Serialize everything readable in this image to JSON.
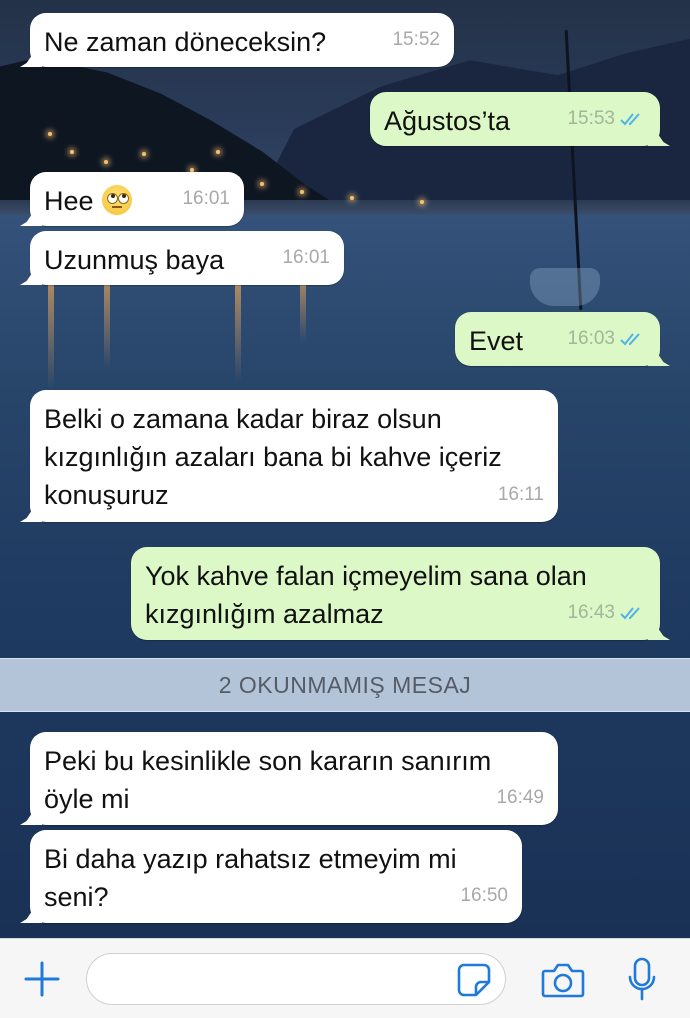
{
  "messages": [
    {
      "dir": "in",
      "text": "Ne zaman döneceksin?",
      "time": "15:52"
    },
    {
      "dir": "out",
      "text": "Ağustos’ta",
      "time": "15:53"
    },
    {
      "dir": "in",
      "text": "Hee",
      "time": "16:01",
      "emoji": "eye-roll-emoji-icon"
    },
    {
      "dir": "in",
      "text": "Uzunmuş baya",
      "time": "16:01"
    },
    {
      "dir": "out",
      "text": "Evet",
      "time": "16:03"
    },
    {
      "dir": "in",
      "text": "Belki o zamana kadar biraz olsun\nkızgınlığın azaları bana bi kahve içeriz\nkonuşuruz",
      "time": "16:11"
    },
    {
      "dir": "out",
      "text": "Yok kahve falan içmeyelim sana olan\nkızgınlığım azalmaz",
      "time": "16:43"
    },
    {
      "dir": "in",
      "text": "Peki bu kesinlikle son kararın sanırım\nöyle mi",
      "time": "16:49"
    },
    {
      "dir": "in",
      "text": "Bi daha yazıp rahatsız etmeyim mi\nseni?",
      "time": "16:50"
    }
  ],
  "unread_banner": "2 OKUNMAMIŞ MESAJ",
  "input": {
    "value": "",
    "placeholder": ""
  },
  "icons": {
    "attach": "plus-icon",
    "sticker": "sticker-icon",
    "camera": "camera-icon",
    "mic": "microphone-icon",
    "read_receipt": "double-check-icon"
  },
  "colors": {
    "incoming_bubble": "#ffffff",
    "outgoing_bubble": "#dcf8c6",
    "accent": "#1f7ad8",
    "read_ticks": "#4fb3e8"
  }
}
